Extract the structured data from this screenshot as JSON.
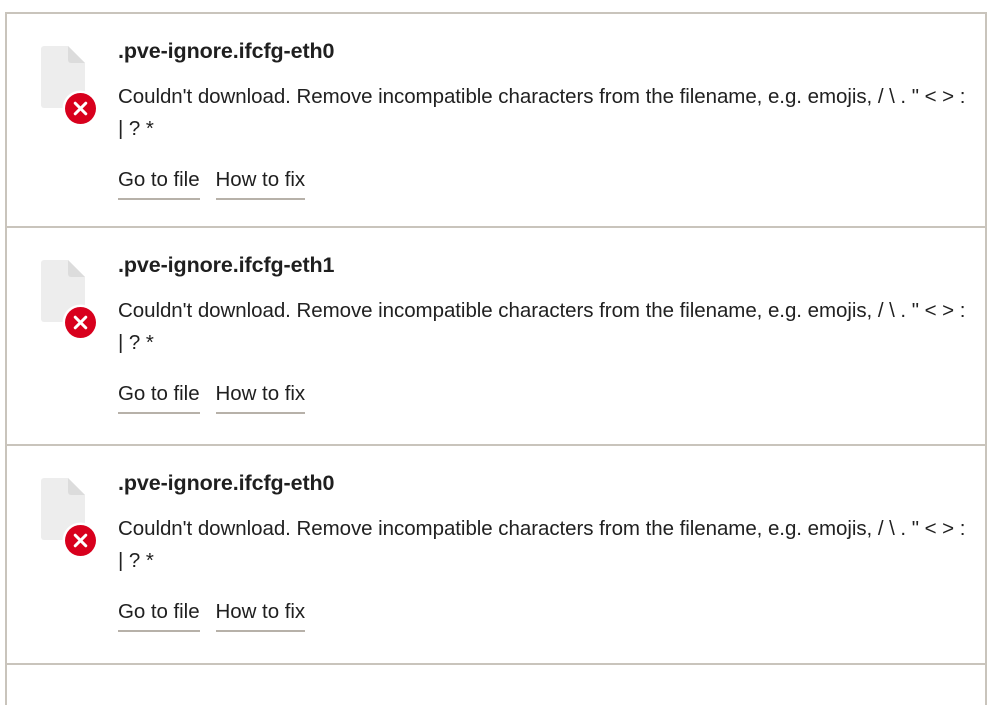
{
  "window": {
    "background_color": "#ffffff",
    "border_color": "#c9c4bc",
    "accent_error_color": "#d8001d",
    "text_color": "#1f1f1f",
    "link_underline_color": "#b7b1a9"
  },
  "error_list": {
    "rows": [
      {
        "icon": "file-document-icon",
        "status_icon": "error-x-badge-icon",
        "file_name": ".pve-ignore.ifcfg-eth0",
        "message_line_1": "Couldn't download. Remove incompatible characters from the filename, e.g.",
        "message_line_2": "emojis, / \\ . \" < > : | ? *",
        "actions": [
          {
            "label": "Go to file",
            "name": "go-to-file-link"
          },
          {
            "label": "How to fix",
            "name": "how-to-fix-link"
          }
        ]
      },
      {
        "icon": "file-document-icon",
        "status_icon": "error-x-badge-icon",
        "file_name": ".pve-ignore.ifcfg-eth1",
        "message_line_1": "Couldn't download. Remove incompatible characters from the filename, e.g.",
        "message_line_2": "emojis, / \\ . \" < > : | ? *",
        "actions": [
          {
            "label": "Go to file",
            "name": "go-to-file-link"
          },
          {
            "label": "How to fix",
            "name": "how-to-fix-link"
          }
        ]
      },
      {
        "icon": "file-document-icon",
        "status_icon": "error-x-badge-icon",
        "file_name": ".pve-ignore.ifcfg-eth0",
        "message_line_1": "Couldn't download. Remove incompatible characters from the filename, e.g.",
        "message_line_2": "emojis, / \\ . \" < > : | ? *",
        "actions": [
          {
            "label": "Go to file",
            "name": "go-to-file-link"
          },
          {
            "label": "How to fix",
            "name": "how-to-fix-link"
          }
        ]
      }
    ]
  }
}
